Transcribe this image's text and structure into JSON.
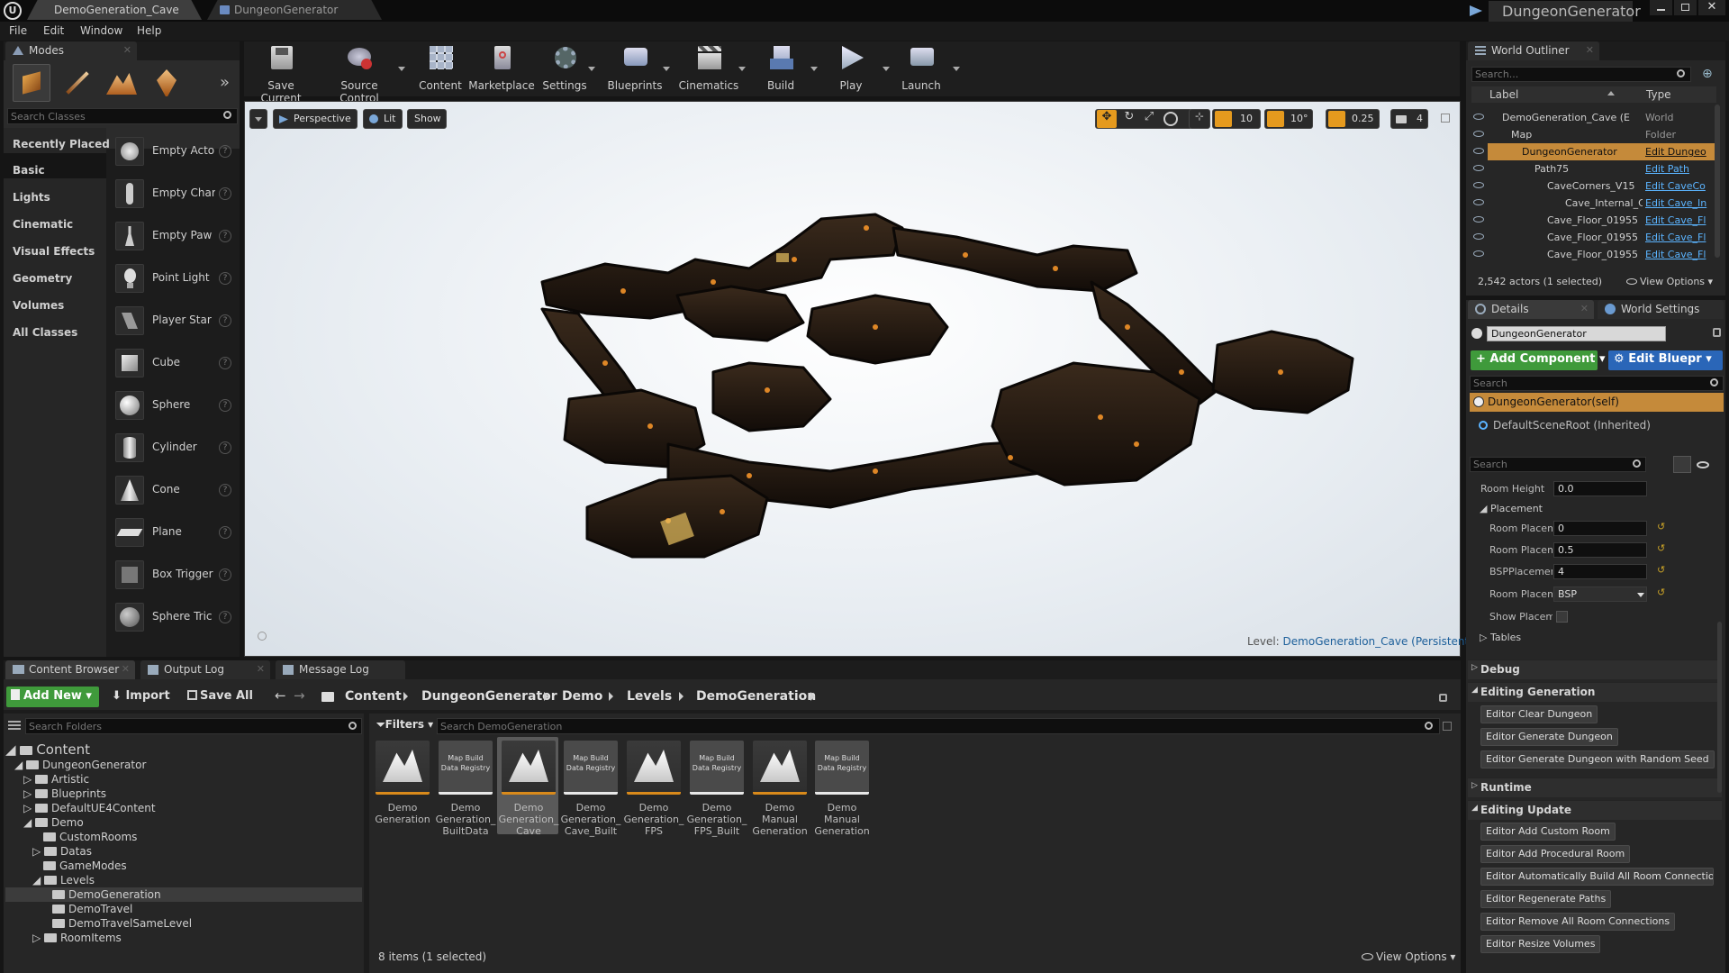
{
  "window": {
    "tabs": [
      "DemoGeneration_Cave",
      "DungeonGenerator"
    ],
    "project_title": "DungeonGenerator",
    "menu": [
      "File",
      "Edit",
      "Window",
      "Help"
    ]
  },
  "modes": {
    "tab_label": "Modes",
    "search_placeholder": "Search Classes",
    "categories": [
      "Recently Placed",
      "Basic",
      "Lights",
      "Cinematic",
      "Visual Effects",
      "Geometry",
      "Volumes",
      "All Classes"
    ],
    "selected_category": "Basic",
    "items": [
      "Empty Acto",
      "Empty Char",
      "Empty Paw",
      "Point Light",
      "Player Star",
      "Cube",
      "Sphere",
      "Cylinder",
      "Cone",
      "Plane",
      "Box Trigger",
      "Sphere Tric"
    ]
  },
  "toolbar": {
    "buttons": [
      "Save Current",
      "Source Control",
      "Content",
      "Marketplace",
      "Settings",
      "Blueprints",
      "Cinematics",
      "Build",
      "Play",
      "Launch"
    ]
  },
  "viewport": {
    "perspective": "Perspective",
    "lit": "Lit",
    "show": "Show",
    "grid_snap": "10",
    "rotation_snap": "10°",
    "scale_snap": "0.25",
    "camera_speed": "4",
    "level_label": "Level:",
    "level_name": "DemoGeneration_Cave (Persistent)"
  },
  "outliner": {
    "tab_label": "World Outliner",
    "search_placeholder": "Search...",
    "col_label": "Label",
    "col_type": "Type",
    "rows": [
      {
        "name": "DemoGeneration_Cave (E",
        "type": "World"
      },
      {
        "name": "Map",
        "type": "Folder"
      },
      {
        "name": "DungeonGenerator",
        "type": "Edit Dungeo"
      },
      {
        "name": "Path75",
        "type": "Edit Path"
      },
      {
        "name": "CaveCorners_V15",
        "type": "Edit CaveCo"
      },
      {
        "name": "Cave_Internal_C",
        "type": "Edit Cave_In"
      },
      {
        "name": "Cave_Floor_01955",
        "type": "Edit Cave_Fl"
      },
      {
        "name": "Cave_Floor_01955",
        "type": "Edit Cave_Fl"
      },
      {
        "name": "Cave_Floor_01955",
        "type": "Edit Cave_Fl"
      }
    ],
    "status": "2,542 actors (1 selected)",
    "view_options": "View Options"
  },
  "details": {
    "tab_details": "Details",
    "tab_world_settings": "World Settings",
    "actor_name": "DungeonGenerator",
    "add_component": "+ Add Component",
    "edit_blueprint": "Edit Bluepr",
    "search_placeholder": "Search",
    "components": [
      "DungeonGenerator(self)",
      "DefaultSceneRoot (Inherited)"
    ],
    "props_search_placeholder": "Search",
    "room_height_label": "Room Height",
    "room_height_value": "0.0",
    "placement_label": "Placement",
    "placement_props": [
      {
        "label": "Room Placem",
        "value": "0"
      },
      {
        "label": "Room Placem",
        "value": "0.5"
      },
      {
        "label": "BSPPlacemer",
        "value": "4"
      },
      {
        "label": "Room Placem",
        "value": "BSP"
      }
    ],
    "show_placement_label": "Show Placem",
    "tables_label": "Tables",
    "debug_label": "Debug",
    "editing_generation_label": "Editing Generation",
    "editing_generation_buttons": [
      "Editor Clear Dungeon",
      "Editor Generate Dungeon",
      "Editor Generate Dungeon with Random Seed"
    ],
    "runtime_label": "Runtime",
    "editing_update_label": "Editing Update",
    "editing_update_buttons": [
      "Editor Add Custom Room",
      "Editor Add Procedural Room",
      "Editor Automatically Build All Room Connectio",
      "Editor Regenerate Paths",
      "Editor Remove All Room Connections",
      "Editor Resize Volumes"
    ]
  },
  "bottom_tabs": [
    "Content Browser",
    "Output Log",
    "Message Log"
  ],
  "content_browser": {
    "add_new": "Add New",
    "import": "Import",
    "save_all": "Save All",
    "breadcrumb": [
      "Content",
      "DungeonGenerator",
      "Demo",
      "Levels",
      "DemoGeneration"
    ],
    "search_folders_placeholder": "Search Folders",
    "filters": "Filters",
    "search_assets_placeholder": "Search DemoGeneration",
    "folders": [
      "Content",
      "DungeonGenerator",
      "Artistic",
      "Blueprints",
      "DefaultUE4Content",
      "Demo",
      "CustomRooms",
      "Datas",
      "GameModes",
      "Levels",
      "DemoGeneration",
      "DemoTravel",
      "DemoTravelSameLevel",
      "RoomItems"
    ],
    "selected_folder": "DemoGeneration",
    "assets": [
      {
        "kind": "map",
        "name": "Demo Generation"
      },
      {
        "kind": "registry",
        "name": "Demo Generation_ BuiltData"
      },
      {
        "kind": "map",
        "name": "Demo Generation_ Cave"
      },
      {
        "kind": "registry",
        "name": "Demo Generation_ Cave_Built"
      },
      {
        "kind": "map",
        "name": "Demo Generation_ FPS"
      },
      {
        "kind": "registry",
        "name": "Demo Generation_ FPS_Built"
      },
      {
        "kind": "map",
        "name": "Demo Manual Generation"
      },
      {
        "kind": "registry",
        "name": "Demo Manual Generation"
      }
    ],
    "registry_thumb_label": "Map Build Data Registry",
    "status": "8 items (1 selected)",
    "view_options": "View Options"
  },
  "colors": {
    "accent_orange": "#e8a020",
    "selection": "#c58a3a",
    "add_green": "#3f9a3b",
    "blue_button": "#2a66b8",
    "link_blue": "#5bb4ff"
  }
}
